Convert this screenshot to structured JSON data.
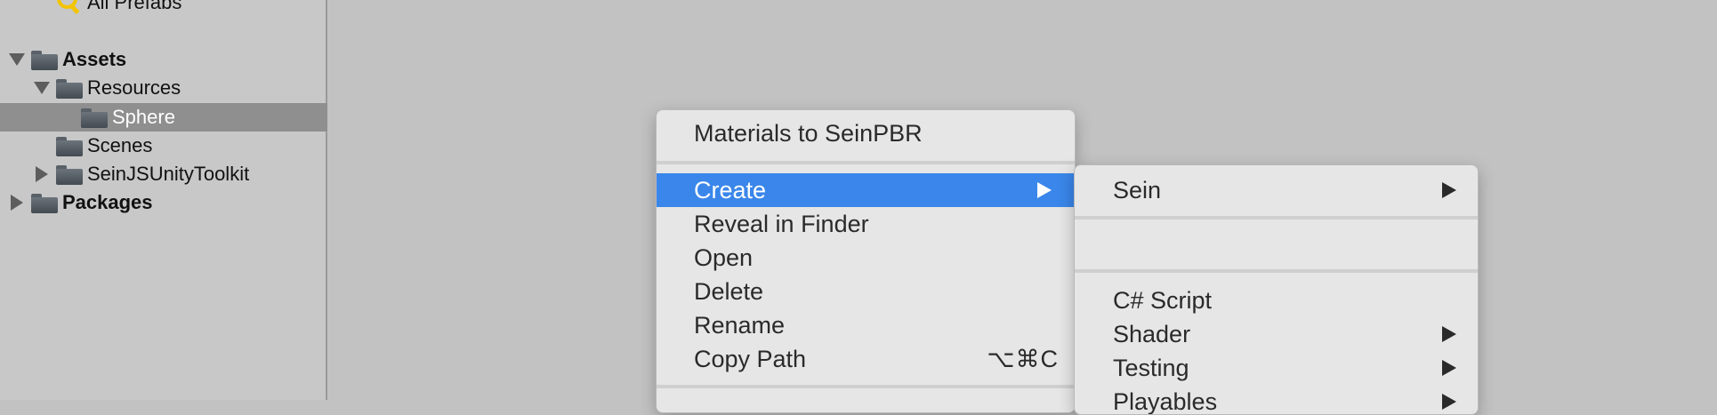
{
  "project": {
    "all_prefabs": "All Prefabs",
    "assets": "Assets",
    "resources": "Resources",
    "sphere": "Sphere",
    "scenes": "Scenes",
    "toolkit": "SeinJSUnityToolkit",
    "packages": "Packages"
  },
  "context_menu": {
    "materials": "Materials to SeinPBR",
    "create": "Create",
    "reveal": "Reveal in Finder",
    "open": "Open",
    "delete": "Delete",
    "rename": "Rename",
    "copy_path": "Copy Path",
    "copy_path_shortcut": "⌥⌘C"
  },
  "create_submenu": {
    "sein": "Sein",
    "csharp": "C# Script",
    "shader": "Shader",
    "testing": "Testing",
    "playables": "Playables"
  },
  "colors": {
    "highlight": "#3a86ea",
    "selected_row": "#8f8f8f",
    "search_icon": "#f2c500"
  }
}
